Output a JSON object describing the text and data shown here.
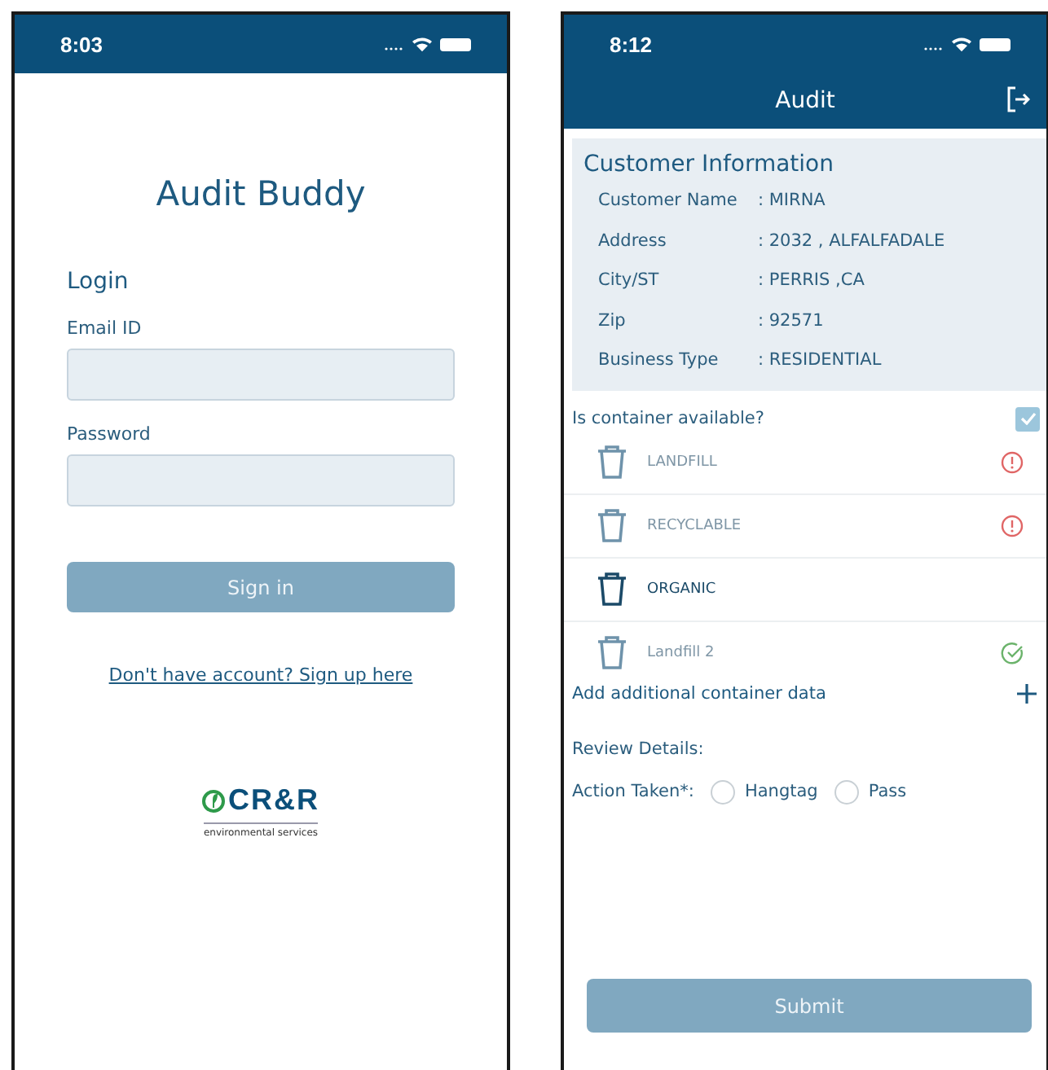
{
  "login_screen": {
    "status_bar": {
      "time": "8:03"
    },
    "app_title": "Audit Buddy",
    "form_title": "Login",
    "fields": [
      {
        "label": "Email ID"
      },
      {
        "label": "Password"
      }
    ],
    "sign_in_button": "Sign in",
    "signup_link": "Don't have account? Sign up here",
    "logo": {
      "name": "CR&R",
      "tagline": "environmental services"
    }
  },
  "audit_screen": {
    "status_bar": {
      "time": "8:12"
    },
    "title": "Audit",
    "customer_info": {
      "title": "Customer Information",
      "rows": [
        {
          "label": "Customer Name",
          "value": ": MIRNA"
        },
        {
          "label": "Address",
          "value": ": 2032 , ALFALFADALE"
        },
        {
          "label": "City/ST",
          "value": ": PERRIS ,CA"
        },
        {
          "label": "Zip",
          "value": ": 92571"
        },
        {
          "label": "Business Type",
          "value": ": RESIDENTIAL"
        }
      ]
    },
    "container_question": {
      "label": "Is container available?",
      "checked": true
    },
    "containers": [
      {
        "name": "LANDFILL",
        "kind": "warning",
        "selected": false
      },
      {
        "name": "RECYCLABLE",
        "kind": "warning",
        "selected": false
      },
      {
        "name": "ORGANIC",
        "kind": "plain",
        "selected": true
      },
      {
        "name": "Landfill 2",
        "kind": "done",
        "selected": false
      }
    ],
    "add_container": "Add additional container data",
    "review_label": "Review Details:",
    "action": {
      "label": "Action Taken*:",
      "options": [
        {
          "label": "Hangtag",
          "selected": false
        },
        {
          "label": "Pass",
          "selected": false
        }
      ]
    },
    "submit_button": "Submit"
  }
}
